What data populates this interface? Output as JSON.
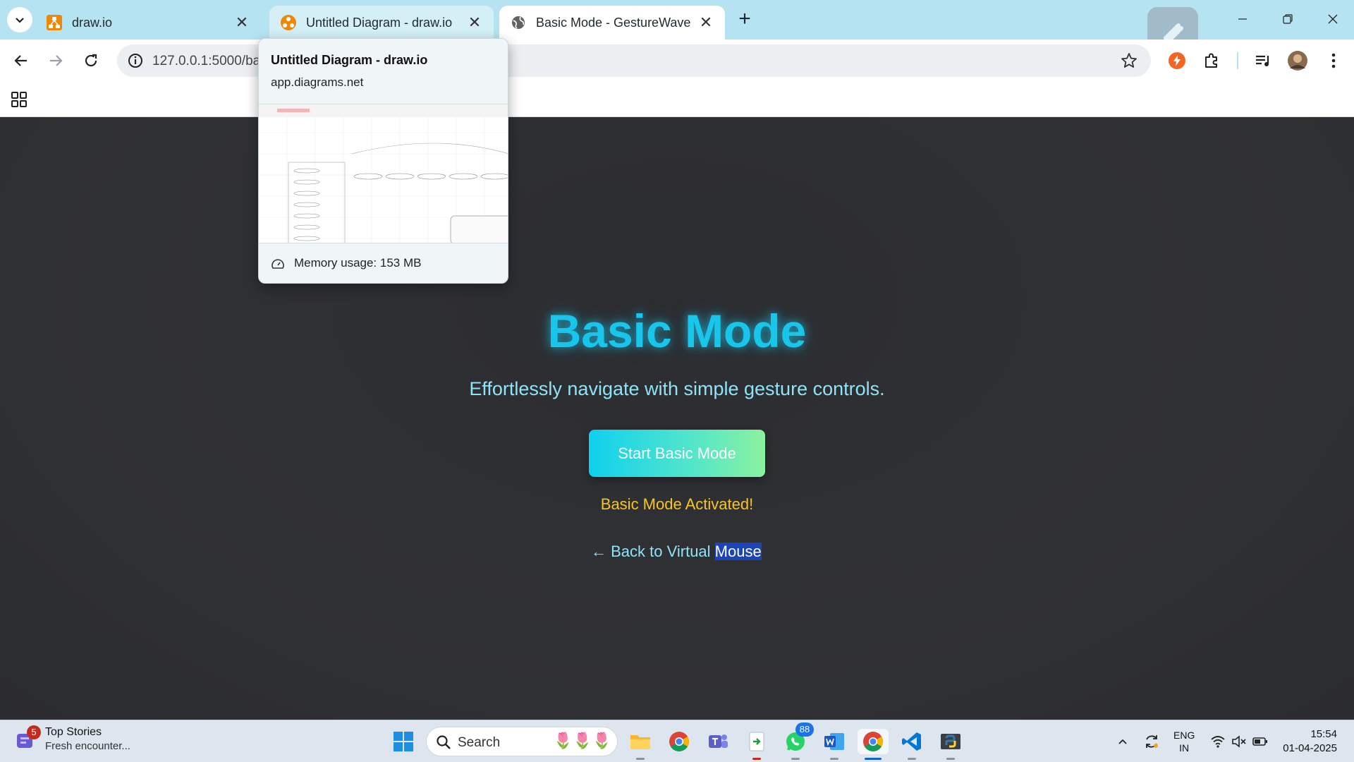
{
  "tabs": [
    {
      "title": "draw.io",
      "close": "✕"
    },
    {
      "title": "Untitled Diagram - draw.io",
      "close": "✕"
    },
    {
      "title": "Basic Mode - GestureWave",
      "close": "✕"
    }
  ],
  "new_tab": "+",
  "window_controls": {
    "minimize": "minimize-icon",
    "restore": "restore-icon",
    "close": "close-icon"
  },
  "toolbar": {
    "url": "127.0.0.1:5000/ba"
  },
  "hover_card": {
    "title": "Untitled Diagram - draw.io",
    "url": "app.diagrams.net",
    "memory": "Memory usage: 153 MB"
  },
  "page": {
    "title": "Basic Mode",
    "subtitle": "Effortlessly navigate with simple gesture controls.",
    "start_button": "Start Basic Mode",
    "status": "Basic Mode Activated!",
    "back_prefix": "← Back to Virtual ",
    "back_selected": "Mouse"
  },
  "colors": {
    "title": "#18c6ec",
    "status": "#f7c51e",
    "background": "#2f3033",
    "tabstrip": "#b6e3f1"
  },
  "taskbar": {
    "news_badge": "5",
    "news_title": "Top Stories",
    "news_sub": "Fresh encounter...",
    "search_label": "Search",
    "whatsapp_badge": "88",
    "lang_line1": "ENG",
    "lang_line2": "IN",
    "time": "15:54",
    "date": "01-04-2025"
  }
}
